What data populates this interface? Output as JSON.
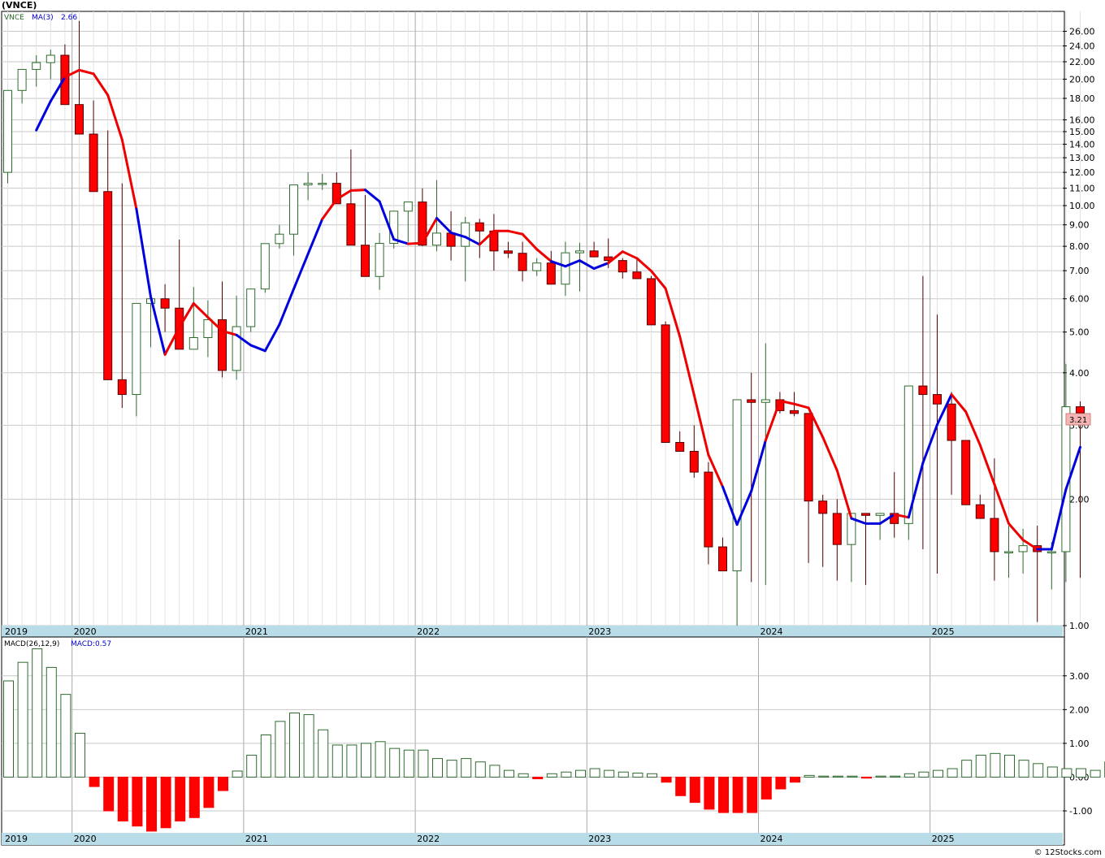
{
  "header": {
    "ticker_title": "(VNCE)",
    "price_legend_symbol": "VNCE",
    "price_legend_ma_label": "MA(3)",
    "price_legend_ma_value": "2.66",
    "macd_legend_label": "MACD(26,12,9)",
    "macd_legend_value": "MACD:0.57",
    "watermark": "© 12Stocks.com",
    "last_price_badge": "3.21"
  },
  "colors": {
    "up_candle": "#2e6b2e",
    "down_candle": "#ff0000",
    "ma_up": "#0000dd",
    "ma_down": "#ee0000",
    "macd_positive": "#2e6b2e",
    "macd_negative": "#ff0000",
    "axis_strip": "#b8dce8",
    "grid": "#c8c8c8",
    "badge": "#f5b5b5"
  },
  "chart_data": [
    {
      "type": "candlestick",
      "title": "(VNCE)",
      "scale": "log",
      "ylim": [
        1.0,
        29.0
      ],
      "y_ticks": [
        "1.00",
        "2.00",
        "3.00",
        "4.00",
        "5.00",
        "6.00",
        "7.00",
        "8.00",
        "9.00",
        "10.00",
        "11.00",
        "12.00",
        "13.00",
        "14.00",
        "15.00",
        "16.00",
        "18.00",
        "20.00",
        "22.00",
        "24.00",
        "26.00"
      ],
      "x_labels": [
        "2019",
        "2020",
        "2021",
        "2022",
        "2023",
        "2024",
        "2025"
      ],
      "x_label_months": [
        "2019-08",
        "2020-01",
        "2021-01",
        "2022-01",
        "2023-01",
        "2024-01",
        "2025-01"
      ],
      "grid": true,
      "ma_period": 3,
      "ma_last": 2.66,
      "last_close": 3.21,
      "months": [
        "2019-08",
        "2019-09",
        "2019-10",
        "2019-11",
        "2019-12",
        "2020-01",
        "2020-02",
        "2020-03",
        "2020-04",
        "2020-05",
        "2020-06",
        "2020-07",
        "2020-08",
        "2020-09",
        "2020-10",
        "2020-11",
        "2020-12",
        "2021-01",
        "2021-02",
        "2021-03",
        "2021-04",
        "2021-05",
        "2021-06",
        "2021-07",
        "2021-08",
        "2021-09",
        "2021-10",
        "2021-11",
        "2021-12",
        "2022-01",
        "2022-02",
        "2022-03",
        "2022-04",
        "2022-05",
        "2022-06",
        "2022-07",
        "2022-08",
        "2022-09",
        "2022-10",
        "2022-11",
        "2022-12",
        "2023-01",
        "2023-02",
        "2023-03",
        "2023-04",
        "2023-05",
        "2023-06",
        "2023-07",
        "2023-08",
        "2023-09",
        "2023-10",
        "2023-11",
        "2023-12",
        "2024-01",
        "2024-02",
        "2024-03",
        "2024-04",
        "2024-05",
        "2024-06",
        "2024-07",
        "2024-08",
        "2024-09",
        "2024-10",
        "2024-11",
        "2024-12",
        "2025-01",
        "2025-02",
        "2025-03",
        "2025-04",
        "2025-05",
        "2025-06",
        "2025-07",
        "2025-08",
        "2025-09",
        "2025-10",
        "2025-11"
      ],
      "open": [
        12.0,
        18.8,
        21.1,
        21.9,
        22.8,
        17.4,
        14.8,
        10.8,
        3.85,
        3.55,
        5.85,
        6.0,
        5.7,
        4.55,
        4.85,
        5.35,
        4.05,
        5.15,
        6.33,
        8.12,
        8.55,
        11.2,
        11.3,
        11.3,
        10.1,
        8.05,
        6.78,
        8.13,
        9.7,
        10.2,
        8.05,
        8.6,
        8.0,
        9.1,
        8.7,
        7.8,
        7.7,
        7.0,
        7.3,
        6.5,
        7.72,
        7.8,
        7.55,
        7.4,
        6.95,
        6.7,
        5.2,
        2.73,
        2.6,
        2.32,
        1.54,
        1.35,
        3.45,
        3.4,
        3.45,
        3.25,
        3.2,
        1.98,
        1.85,
        1.56,
        1.85,
        1.83,
        1.85,
        1.75,
        3.72,
        3.55,
        3.37,
        2.76,
        1.94,
        1.8,
        1.5,
        1.5,
        1.55,
        1.5,
        1.5,
        3.32
      ],
      "high": [
        13.5,
        20.2,
        22.8,
        23.5,
        24.2,
        27.5,
        17.8,
        15.1,
        11.3,
        4.1,
        6.2,
        6.5,
        8.3,
        6.4,
        5.95,
        6.6,
        6.1,
        5.95,
        8.1,
        9.0,
        10.5,
        12.0,
        11.9,
        12.0,
        13.6,
        10.6,
        8.6,
        8.5,
        10.2,
        11.0,
        11.5,
        9.7,
        9.4,
        9.3,
        9.55,
        8.2,
        8.2,
        7.5,
        7.8,
        8.2,
        8.15,
        8.2,
        8.35,
        7.5,
        7.5,
        6.8,
        5.3,
        2.9,
        3.0,
        2.45,
        1.62,
        1.42,
        4.0,
        4.7,
        3.6,
        3.6,
        3.2,
        2.05,
        2.0,
        1.85,
        1.85,
        1.85,
        2.32,
        2.05,
        6.8,
        5.5,
        3.6,
        2.76,
        2.05,
        2.5,
        1.73,
        1.7,
        1.73,
        1.58,
        4.2,
        3.42
      ],
      "low": [
        11.3,
        17.5,
        19.2,
        20.0,
        20.4,
        16.2,
        14.2,
        9.95,
        3.3,
        3.15,
        4.6,
        5.0,
        4.8,
        4.6,
        4.36,
        3.9,
        3.85,
        5.0,
        6.2,
        7.9,
        7.6,
        10.3,
        10.9,
        10.5,
        10.1,
        7.9,
        6.3,
        7.9,
        8.2,
        8.0,
        7.8,
        7.4,
        6.6,
        7.5,
        7.0,
        7.5,
        6.6,
        6.8,
        6.7,
        6.1,
        6.25,
        7.6,
        7.1,
        6.7,
        6.7,
        6.65,
        4.9,
        2.6,
        2.25,
        1.4,
        1.35,
        1.0,
        1.27,
        1.25,
        3.2,
        3.15,
        1.41,
        1.38,
        1.28,
        1.27,
        1.25,
        1.6,
        1.62,
        1.6,
        1.52,
        1.33,
        2.05,
        2.5,
        1.85,
        1.28,
        1.3,
        1.33,
        1.02,
        1.22,
        1.27,
        1.3
      ],
      "close": [
        18.8,
        21.1,
        21.9,
        22.8,
        17.4,
        14.8,
        10.8,
        3.85,
        3.55,
        5.85,
        6.0,
        5.7,
        4.55,
        4.85,
        5.35,
        4.05,
        5.15,
        6.33,
        8.12,
        8.55,
        11.2,
        11.3,
        11.3,
        10.1,
        8.05,
        6.78,
        8.13,
        9.7,
        10.2,
        8.05,
        8.6,
        8.0,
        9.1,
        8.7,
        7.8,
        7.7,
        7.0,
        7.3,
        6.5,
        7.72,
        7.8,
        7.55,
        7.4,
        6.95,
        6.7,
        5.2,
        2.73,
        2.6,
        2.32,
        1.54,
        1.35,
        3.45,
        3.4,
        3.45,
        3.25,
        3.2,
        1.98,
        1.85,
        1.56,
        1.85,
        1.83,
        1.85,
        1.75,
        3.72,
        3.55,
        3.37,
        2.76,
        1.94,
        1.8,
        1.5,
        1.5,
        1.55,
        1.5,
        1.5,
        3.32,
        3.21
      ],
      "ma": [
        null,
        null,
        15.12,
        17.72,
        20.22,
        21.02,
        20.6,
        18.33,
        14.35,
        9.82,
        6.07,
        4.42,
        5.13,
        5.85,
        5.42,
        5.03,
        4.92,
        4.65,
        4.51,
        5.21,
        6.33,
        7.67,
        9.29,
        10.35,
        10.86,
        10.9,
        10.23,
        8.31,
        8.11,
        8.14,
        9.33,
        8.62,
        8.42,
        8.08,
        8.7,
        8.7,
        8.55,
        7.87,
        7.37,
        7.17,
        7.4,
        7.08,
        7.3,
        7.77,
        7.49,
        6.99,
        6.35,
        4.88,
        3.54,
        2.55,
        2.14,
        1.74,
        2.09,
        2.76,
        3.43,
        3.37,
        3.3,
        2.81,
        2.34,
        1.8,
        1.75,
        1.75,
        1.84,
        1.81,
        2.44,
        3.01,
        3.55,
        3.23,
        2.69,
        2.17,
        1.75,
        1.6,
        1.52,
        1.52,
        2.11,
        2.66
      ],
      "ma_color": [
        "down",
        "down",
        "up",
        "up",
        "up",
        "down",
        "down",
        "down",
        "down",
        "down",
        "up",
        "up",
        "down",
        "down",
        "down",
        "down",
        "down",
        "up",
        "up",
        "up",
        "up",
        "up",
        "up",
        "down",
        "down",
        "down",
        "up",
        "up",
        "up",
        "down",
        "down",
        "up",
        "up",
        "up",
        "down",
        "down",
        "down",
        "down",
        "down",
        "up",
        "up",
        "up",
        "up",
        "down",
        "down",
        "down",
        "down",
        "down",
        "down",
        "down",
        "down",
        "up",
        "up",
        "up",
        "down",
        "down",
        "down",
        "down",
        "down",
        "down",
        "up",
        "up",
        "up",
        "down",
        "up",
        "up",
        "up",
        "down",
        "down",
        "down",
        "down",
        "down",
        "down",
        "up",
        "up",
        "up"
      ]
    },
    {
      "type": "bar",
      "title": "MACD(26,12,9)",
      "ylim": [
        -1.65,
        4.15
      ],
      "y_ticks": [
        "-1.00",
        "0.00",
        "1.00",
        "2.00",
        "3.00"
      ],
      "x_labels": [
        "2019",
        "2020",
        "2021",
        "2022",
        "2023",
        "2024",
        "2025"
      ],
      "last_value": 0.57,
      "values": [
        2.85,
        3.4,
        3.8,
        3.25,
        2.45,
        1.3,
        -0.28,
        -1.0,
        -1.3,
        -1.45,
        -1.6,
        -1.5,
        -1.3,
        -1.2,
        -0.9,
        -0.4,
        0.18,
        0.65,
        1.25,
        1.65,
        1.9,
        1.85,
        1.4,
        0.95,
        0.95,
        1.0,
        1.05,
        0.85,
        0.8,
        0.8,
        0.55,
        0.5,
        0.55,
        0.45,
        0.35,
        0.2,
        0.1,
        -0.05,
        0.1,
        0.15,
        0.2,
        0.25,
        0.2,
        0.15,
        0.12,
        0.1,
        -0.15,
        -0.55,
        -0.75,
        -0.95,
        -1.05,
        -1.05,
        -1.05,
        -0.65,
        -0.35,
        -0.15,
        0.05,
        0.03,
        0.03,
        0.03,
        -0.03,
        0.03,
        0.03,
        0.1,
        0.15,
        0.2,
        0.25,
        0.5,
        0.65,
        0.7,
        0.65,
        0.5,
        0.4,
        0.3,
        0.25,
        0.25,
        0.2,
        0.45,
        0.57
      ]
    }
  ]
}
